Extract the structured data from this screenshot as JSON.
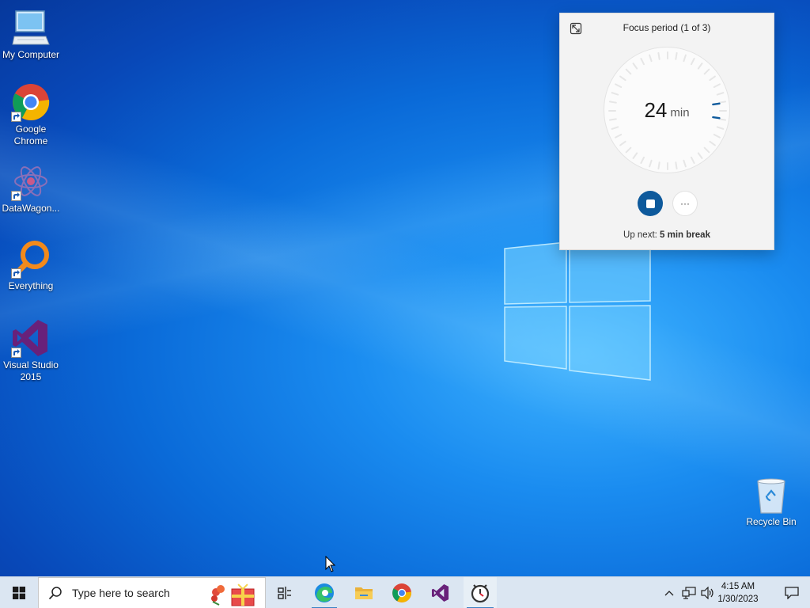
{
  "desktop": {
    "icons": [
      {
        "label": "My Computer",
        "icon": "computer-icon"
      },
      {
        "label": "Google Chrome",
        "icon": "chrome-icon"
      },
      {
        "label": "DataWagon...",
        "icon": "datawagon-icon"
      },
      {
        "label": "Everything",
        "icon": "everything-search-icon"
      },
      {
        "label": "Visual Studio 2015",
        "icon": "visual-studio-icon"
      },
      {
        "label": "Recycle Bin",
        "icon": "recycle-bin-icon"
      }
    ]
  },
  "focus_widget": {
    "title": "Focus period (1 of 3)",
    "minutes": "24",
    "unit": "min",
    "up_next_prefix": "Up next: ",
    "up_next_value": "5 min break",
    "more_label": "···",
    "remaining_fraction": 0.96,
    "accent_color": "#0e5a9c"
  },
  "taskbar": {
    "search_placeholder": "Type here to search",
    "pinned": [
      "task-view-icon",
      "edge-icon",
      "file-explorer-icon",
      "chrome-icon",
      "visual-studio-icon",
      "clock-app-icon"
    ],
    "time": "4:15 AM",
    "date": "1/30/2023"
  }
}
